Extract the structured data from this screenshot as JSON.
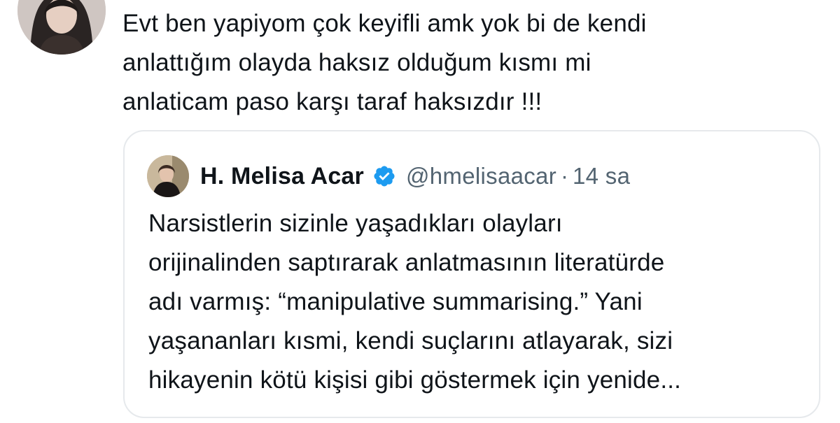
{
  "tweet": {
    "text": "Evt ben yapiyom çok keyifli amk yok bi de kendi\nanlattığım olayda haksız olduğum kısmı mi\nanlaticam paso karşı taraf haksızdır !!!",
    "avatar_icon": "user-avatar-photo"
  },
  "quote": {
    "name": "H. Melisa Acar",
    "handle": "@hmelisaacar",
    "separator": "·",
    "time": "14 sa",
    "verified": true,
    "verified_color": "#1d9bf0",
    "text": "Narsistlerin sizinle yaşadıkları olayları\norijinalinden saptırarak anlatmasının literatürde\nadı varmış: “manipulative summarising.” Yani\nyaşananları kısmi, kendi suçlarını atlayarak, sizi\nhikayenin kötü kişisi gibi göstermek için yenide..."
  },
  "colors": {
    "text": "#0f1419",
    "muted": "#536471",
    "border": "#e6e9ec",
    "background": "#ffffff"
  }
}
